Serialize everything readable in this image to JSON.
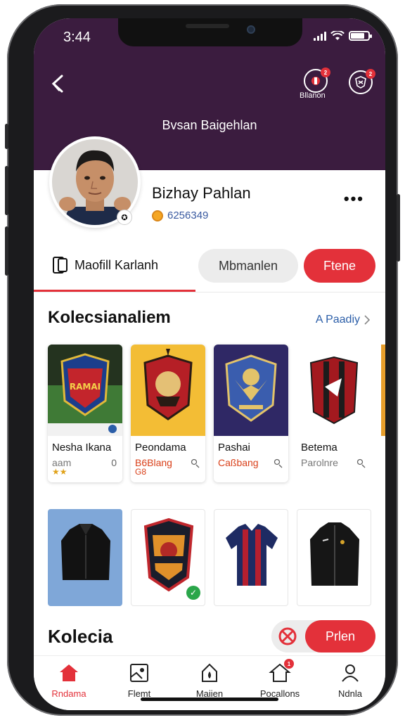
{
  "status_bar": {
    "time": "3:44",
    "battery_level": 0.8
  },
  "header": {
    "back_icon": "back-arrow-icon",
    "icon_1_badge": "2",
    "icon_1_caption": "Bllanon",
    "icon_2_badge": "2",
    "title": "Bvsan Baigehlan"
  },
  "profile": {
    "name": "Bizhay Pahlan",
    "id": "6256349",
    "more_icon": "more-icon"
  },
  "tabs": {
    "active_label": "Maofill Karlanh",
    "gray_label": "Mbmanlen",
    "red_label": "Ftene"
  },
  "section": {
    "title": "Kolecsianaliem",
    "link": "A Paadiy"
  },
  "cards": [
    {
      "name": "Nesha Ikana",
      "sub": "aam",
      "meta": "0",
      "stars": "★★"
    },
    {
      "name": "Peondama",
      "sub": "B6Blang",
      "meta": "",
      "stars": "G8"
    },
    {
      "name": "Pashai",
      "sub": "Caßbang",
      "meta": "",
      "stars": ""
    },
    {
      "name": "Betema",
      "sub": "Parolnre",
      "meta": "",
      "stars": ""
    }
  ],
  "crest_text": "RAMAI",
  "bottom": {
    "title": "Kolecia",
    "toggle_label": "Prlen"
  },
  "nav": [
    {
      "label": "Rndama",
      "icon": "home-icon",
      "active": true
    },
    {
      "label": "Flemt",
      "icon": "frame-icon",
      "active": false
    },
    {
      "label": "Maiien",
      "icon": "bag-icon",
      "active": false
    },
    {
      "label": "Pocallons",
      "icon": "notification-home-icon",
      "active": false,
      "badge": "1"
    },
    {
      "label": "Ndnla",
      "icon": "user-icon",
      "active": false
    }
  ],
  "colors": {
    "header": "#3b1c3f",
    "accent": "#e3313a",
    "link": "#2b5ea8"
  }
}
